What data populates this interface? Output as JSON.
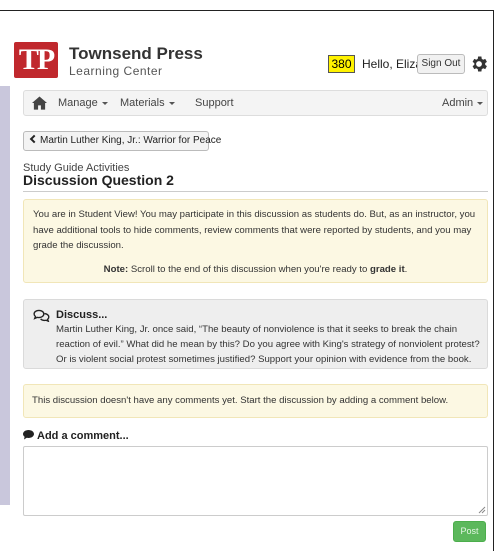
{
  "brand": {
    "logo_text": "TP",
    "name": "Townsend Press",
    "subtitle": "Learning Center"
  },
  "header": {
    "points": "380",
    "greeting": "Hello, Eliza",
    "signout_label": "Sign Out",
    "settings_icon": "gear-icon"
  },
  "navbar": {
    "home_icon": "home-icon",
    "items": [
      {
        "label": "Manage",
        "has_menu": true
      },
      {
        "label": "Materials",
        "has_menu": true
      },
      {
        "label": "Support",
        "has_menu": false
      }
    ],
    "right_item": {
      "label": "Admin",
      "has_menu": true
    }
  },
  "breadcrumb": {
    "back_label": "Martin Luther King, Jr.: Warrior for Peace"
  },
  "page": {
    "section": "Study Guide Activities",
    "title": "Discussion Question 2"
  },
  "notice": {
    "text": "You are in Student View! You may participate in this discussion as students do. But, as an instructor, you have additional tools to hide comments, review comments that were reported by students, and you may grade the discussion.",
    "note_label": "Note:",
    "note_text": " Scroll to the end of this discussion when you're ready to ",
    "note_bold": "grade it",
    "note_end": "."
  },
  "discuss": {
    "icon": "comments-icon",
    "title": "Discuss...",
    "body": "Martin Luther King, Jr. once said, “The beauty of nonviolence is that it seeks to break the chain reaction of evil.” What did he mean by this? Do you agree with King's strategy of nonviolent protest? Or is violent social protest sometimes justified? Support your opinion with evidence from the book."
  },
  "comments": {
    "empty_text": "This discussion doesn't have any comments yet. Start the discussion by adding a comment below.",
    "add_label": "Add a comment...",
    "input_value": "",
    "post_label": "Post"
  },
  "colors": {
    "brand_red": "#c0282d",
    "points_yellow": "#fff200",
    "notice_bg": "#fcf8e3",
    "post_green": "#5cb85c"
  }
}
